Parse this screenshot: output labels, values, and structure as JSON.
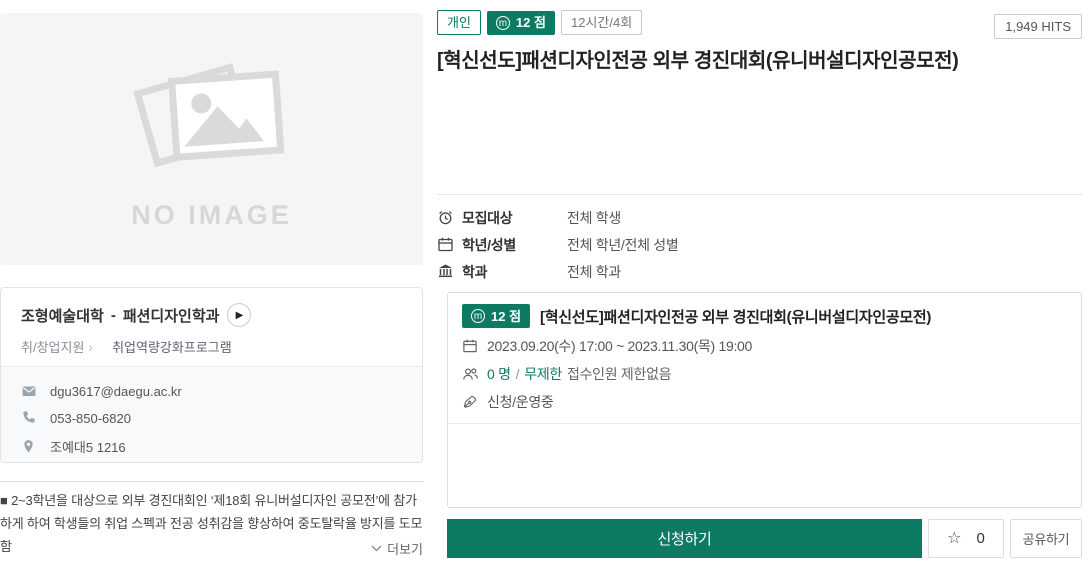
{
  "colors": {
    "accent": "#0d7a63"
  },
  "header": {
    "badges": [
      {
        "label": "개인",
        "style": "outline-green"
      },
      {
        "label": "12 점",
        "style": "filled-green",
        "icon_letter": "m"
      },
      {
        "label": "12시간/4회",
        "style": "outline-gray"
      }
    ],
    "hits": "1,949 HITS",
    "title": "[혁신선도]패션디자인전공 외부 경진대회(유니버설디자인공모전)"
  },
  "image_placeholder": {
    "text": "NO IMAGE"
  },
  "org_card": {
    "college": "조형예술대학",
    "dash": "-",
    "department": "패션디자인학과",
    "category": "취/창업지원",
    "chevron": "›",
    "program_type": "취업역량강화프로그램",
    "email": "dgu3617@daegu.ac.kr",
    "phone": "053-850-6820",
    "location": "조예대5 1216"
  },
  "description": {
    "text": "■ 2~3학년을 대상으로 외부 경진대회인 ‘제18회 유니버설디자인 공모전’에 참가하게 하여 학생들의 취업 스펙과 전공 성취감을 향상하여 중도탈락율 방지를 도모함",
    "more_label": "더보기"
  },
  "info_rows": [
    {
      "icon": "clock-icon",
      "label": "모집대상",
      "value": "전체 학생"
    },
    {
      "icon": "calendar-icon",
      "label": "학년/성별",
      "value": "전체 학년/전체 성별"
    },
    {
      "icon": "bank-icon",
      "label": "학과",
      "value": "전체 학과"
    }
  ],
  "program_box": {
    "points_badge": "12 점",
    "icon_letter": "m",
    "title": "[혁신선도]패션디자인전공 외부 경진대회(유니버설디자인공모전)",
    "date_range": "2023.09.20(수) 17:00 ~ 2023.11.30(목) 19:00",
    "applicants": {
      "count": "0 명",
      "slash": "/",
      "limit": "무제한",
      "note": "접수인원 제한없음"
    },
    "status": "신청/운영중"
  },
  "actions": {
    "apply_label": "신청하기",
    "favorite_star": "☆",
    "favorite_count": "0",
    "share_label": "공유하기"
  }
}
